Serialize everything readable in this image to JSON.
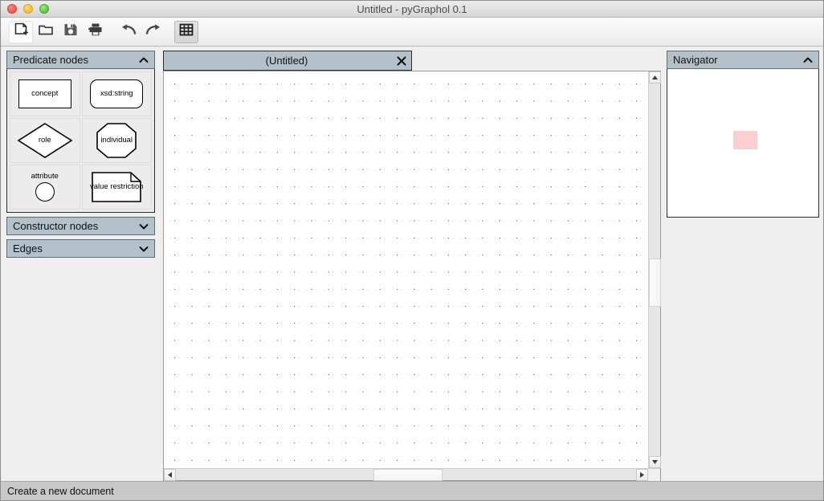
{
  "window": {
    "title": "Untitled - pyGraphol 0.1",
    "controls": [
      {
        "name": "close",
        "color": "#ef5349"
      },
      {
        "name": "minimize",
        "color": "#f5bd2f"
      },
      {
        "name": "zoom",
        "color": "#5cc53d"
      }
    ]
  },
  "toolbar": {
    "buttons": [
      {
        "icon": "new-document-icon",
        "label": "New",
        "state": "hover"
      },
      {
        "icon": "open-folder-icon",
        "label": "Open",
        "state": "normal"
      },
      {
        "icon": "save-floppy-icon",
        "label": "Save",
        "state": "normal"
      },
      {
        "icon": "print-icon",
        "label": "Print",
        "state": "normal"
      },
      {
        "icon": "undo-arrow-icon",
        "label": "Undo",
        "state": "normal"
      },
      {
        "icon": "redo-arrow-icon",
        "label": "Redo",
        "state": "normal"
      },
      {
        "icon": "grid-icon",
        "label": "Toggle grid",
        "state": "pressed"
      }
    ]
  },
  "left_dock": {
    "panels": [
      {
        "title": "Predicate nodes",
        "expanded": true,
        "chevron": "chevron-up-icon",
        "items": [
          {
            "label": "concept",
            "shape": "rectangle"
          },
          {
            "label": "xsd:string",
            "shape": "rounded-rectangle"
          },
          {
            "label": "role",
            "shape": "diamond"
          },
          {
            "label": "individual",
            "shape": "octagon"
          },
          {
            "label": "attribute",
            "shape": "circle"
          },
          {
            "label": "value restriction",
            "shape": "note"
          }
        ]
      },
      {
        "title": "Constructor nodes",
        "expanded": false,
        "chevron": "chevron-down-icon",
        "items": []
      },
      {
        "title": "Edges",
        "expanded": false,
        "chevron": "chevron-down-icon",
        "items": []
      }
    ]
  },
  "center": {
    "tab": {
      "label": "(Untitled)",
      "close_icon": "close-icon"
    },
    "canvas": {
      "grid_visible": true,
      "grid_spacing": 21
    },
    "vertical_scrollbar": {
      "up_icon": "triangle-up-icon",
      "down_icon": "triangle-down-icon",
      "thumb_top_pct": 47,
      "thumb_height_pct": 13
    },
    "horizontal_scrollbar": {
      "left_icon": "triangle-left-icon",
      "right_icon": "triangle-right-icon",
      "thumb_left_pct": 43,
      "thumb_width_pct": 15
    }
  },
  "right_dock": {
    "panel": {
      "title": "Navigator",
      "expanded": true,
      "chevron": "chevron-up-icon",
      "viewport_color": "#fbcfcf"
    }
  },
  "statusbar": {
    "message": "Create a new document"
  }
}
